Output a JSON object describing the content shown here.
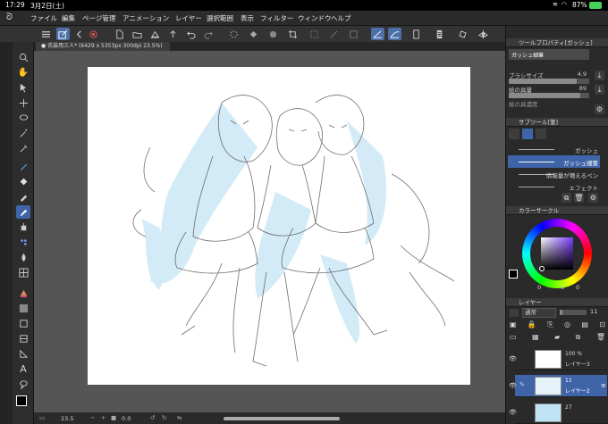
{
  "status": {
    "time": "17:29",
    "date": "3月2日(土)",
    "battery": "87%"
  },
  "menu": [
    "ファイル",
    "編集",
    "ページ管理",
    "アニメーション",
    "レイヤー",
    "選択範囲",
    "表示",
    "フィルター",
    "ウィンドウ",
    "ヘルプ"
  ],
  "document": {
    "tab_title": "● 衣装用三人* (6429 x 5353px 300dpi 23.5%)"
  },
  "bottom": {
    "zoom": "23.5",
    "angle": "0.0"
  },
  "tool_property": {
    "title": "ツールプロパティ[ガッシュ]",
    "brush_name": "ガッシュ細筆",
    "brush_size_label": "ブラシサイズ",
    "brush_size_value": "4.9",
    "brush_size_fraction": 0.84,
    "paint_amount_label": "絵の具量",
    "paint_amount_value": "89",
    "paint_amount_fraction": 0.89,
    "paint_density_label": "絵の具濃度"
  },
  "subtool": {
    "title": "サブツール[筆]",
    "items": [
      "ガッシュ",
      "ガッシュ細筆",
      "情報量が増えるペン",
      "エフェクト"
    ],
    "selected_index": 1
  },
  "color_circle": {
    "title": "カラーサークル",
    "values": [
      "0",
      "0",
      "0"
    ],
    "hue_color": "#7c3cff"
  },
  "layer": {
    "title": "レイヤー",
    "blend_mode": "通常",
    "opacity_value": "11",
    "rows": [
      {
        "opacity": "100 %",
        "name": "レイヤー3"
      },
      {
        "opacity": "11",
        "name": "レイヤー2"
      },
      {
        "opacity": "27",
        "name": ""
      }
    ]
  },
  "colors": {
    "accent": "#4d6fa8",
    "selection": "#3f64a8",
    "sketch_blue": "#a9d8ef"
  }
}
